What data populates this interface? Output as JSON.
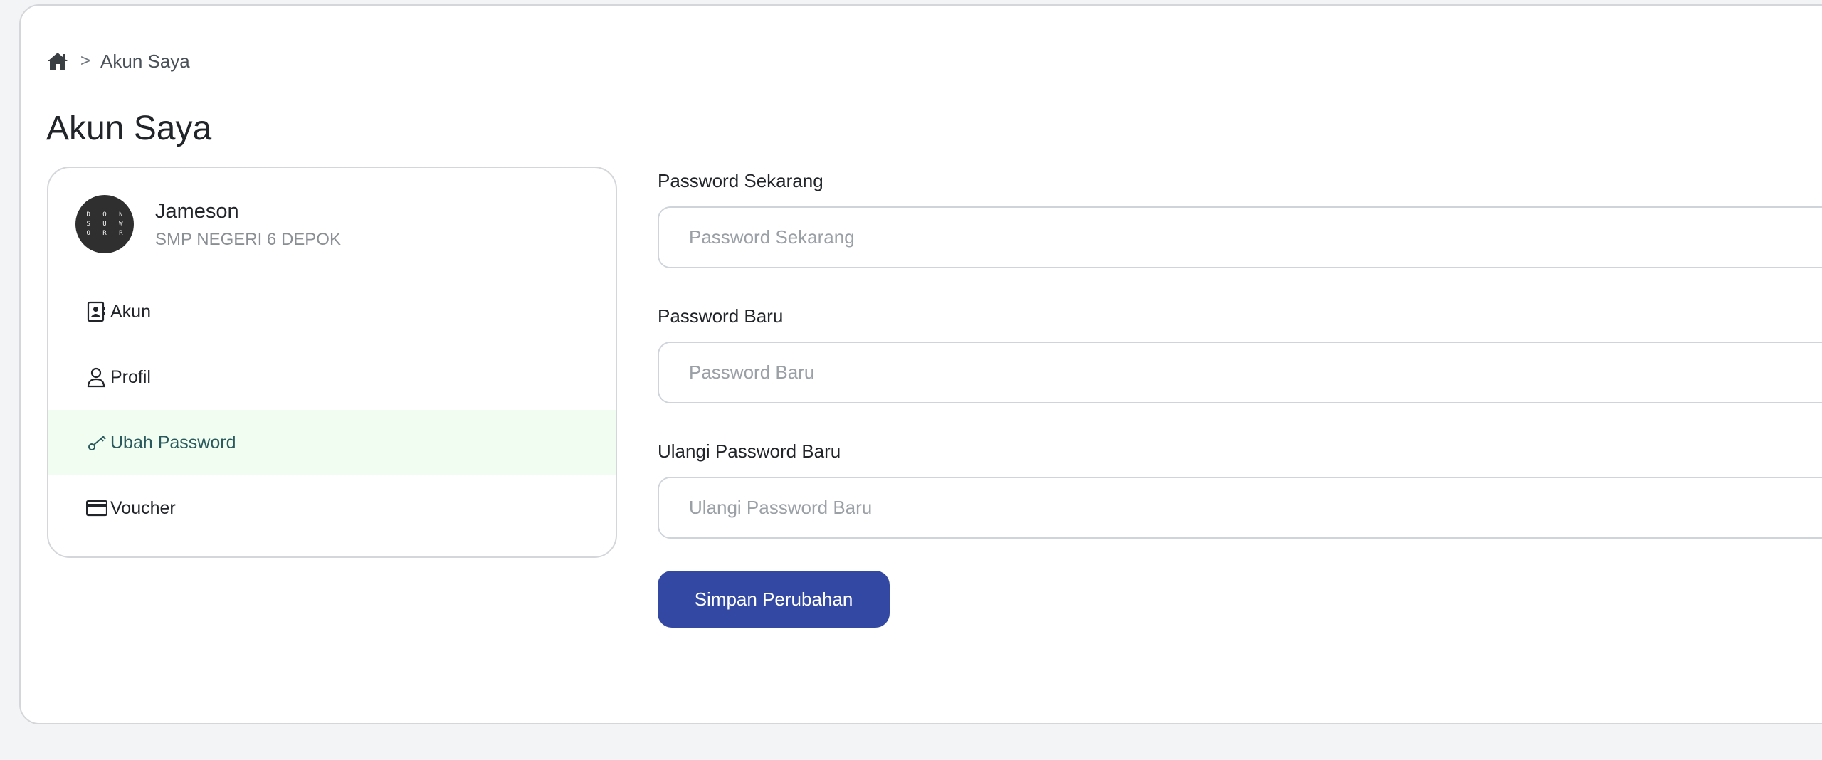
{
  "breadcrumb": {
    "home_icon": "home-icon",
    "separator": ">",
    "current": "Akun Saya"
  },
  "page_title": "Akun Saya",
  "profile": {
    "avatar_lines": [
      "D O N",
      "S U W",
      "O R R"
    ],
    "name": "Jameson",
    "school": "SMP NEGERI 6 DEPOK"
  },
  "menu": {
    "items": [
      {
        "label": "Akun",
        "icon": "contact-card-icon",
        "active": false
      },
      {
        "label": "Profil",
        "icon": "person-icon",
        "active": false
      },
      {
        "label": "Ubah Password",
        "icon": "key-icon",
        "active": true
      },
      {
        "label": "Voucher",
        "icon": "credit-card-icon",
        "active": false
      }
    ],
    "active_bg": "#f0fdf0",
    "active_color": "#2b5a5e"
  },
  "form": {
    "current_password": {
      "label": "Password Sekarang",
      "placeholder": "Password Sekarang",
      "value": ""
    },
    "new_password": {
      "label": "Password Baru",
      "placeholder": "Password Baru",
      "value": ""
    },
    "repeat_password": {
      "label": "Ulangi Password Baru",
      "placeholder": "Ulangi Password Baru",
      "value": ""
    },
    "toggle_icon": "eye-slash-icon",
    "save_label": "Simpan Perubahan",
    "save_color": "#3348a2"
  }
}
